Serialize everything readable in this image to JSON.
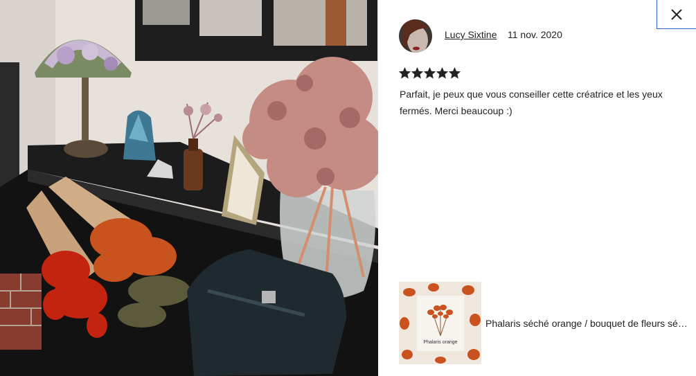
{
  "close_button": {
    "icon": "close-icon",
    "accent_color": "#2a61d6"
  },
  "review": {
    "reviewer_name": "Lucy Sixtine",
    "date": "11 nov. 2020",
    "rating": 5,
    "rating_max": 5,
    "text": "Parfait, je peux que vous conseiller cette créatrice et les yeux fermés. Merci beaucoup :)"
  },
  "product": {
    "title": "Phalaris séché orange / bouquet de fleurs séchées",
    "thumbnail_label": "Phalaris orange"
  },
  "colors": {
    "text": "#222222",
    "star": "#222222",
    "photo_orange": "#c9531e",
    "photo_red": "#c2240f"
  }
}
